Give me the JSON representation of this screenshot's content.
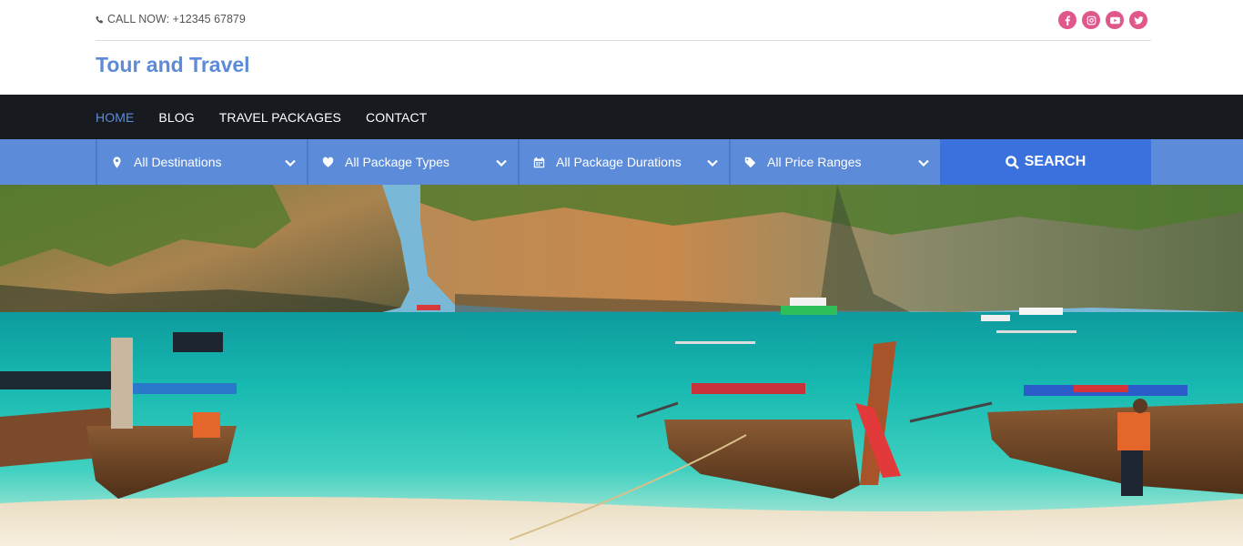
{
  "topbar": {
    "call_text": "CALL NOW: +12345 67879",
    "social": [
      {
        "name": "facebook",
        "icon": "facebook-icon"
      },
      {
        "name": "instagram",
        "icon": "instagram-icon"
      },
      {
        "name": "youtube",
        "icon": "youtube-icon"
      },
      {
        "name": "twitter",
        "icon": "twitter-icon"
      }
    ]
  },
  "brand": {
    "title": "Tour and Travel"
  },
  "nav": {
    "items": [
      {
        "label": "HOME",
        "active": true
      },
      {
        "label": "BLOG"
      },
      {
        "label": "TRAVEL PACKAGES"
      },
      {
        "label": "CONTACT"
      }
    ]
  },
  "search": {
    "filters": [
      {
        "label": "All Destinations",
        "icon": "map-marker-icon"
      },
      {
        "label": "All Package Types",
        "icon": "heart-icon"
      },
      {
        "label": "All Package Durations",
        "icon": "calendar-icon"
      },
      {
        "label": "All Price Ranges",
        "icon": "tag-icon"
      }
    ],
    "button_label": "SEARCH"
  },
  "colors": {
    "accent": "#5b8bd9",
    "nav_bg": "#171b20",
    "search_button": "#3a71dc",
    "social": "#e0578b"
  }
}
